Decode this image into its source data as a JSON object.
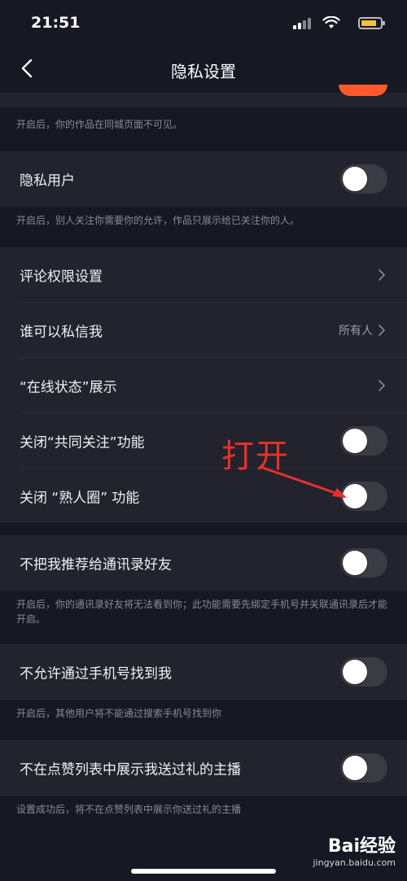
{
  "status": {
    "time": "21:51",
    "battery_color": "#f4c13c"
  },
  "header": {
    "title": "隐私设置"
  },
  "sections": {
    "same_city_desc": "开启后，你的作品在同城页面不可见。",
    "private_user": {
      "label": "隐私用户",
      "desc": "开启后，别人关注你需要你的允许，作品只展示给已关注你的人。",
      "on": false
    },
    "comment_permission": {
      "label": "评论权限设置"
    },
    "who_can_message": {
      "label": "谁可以私信我",
      "value": "所有人"
    },
    "online_status": {
      "label": "“在线状态”展示"
    },
    "mutual_follow": {
      "label": "关闭“共同关注”功能",
      "on": false
    },
    "acquaintance": {
      "label": "关闭 “熟人圈” 功能",
      "on": false
    },
    "no_recommend_contacts": {
      "label": "不把我推荐给通讯录好友",
      "desc": "开启后，你的通讯录好友将无法看到你；此功能需要先绑定手机号并关联通讯录后才能开启。",
      "on": false
    },
    "no_find_by_phone": {
      "label": "不允许通过手机号找到我",
      "desc": "开启后，其他用户将不能通过搜索手机号找到你",
      "on": false
    },
    "hide_gift_likes": {
      "label": "不在点赞列表中展示我送过礼的主播",
      "desc": "设置成功后，将不在点赞列表中展示你送过礼的主播",
      "on": false
    }
  },
  "annotation": {
    "text": "打开",
    "color": "#e4322b"
  },
  "watermark": {
    "logo": "Bai经验",
    "url": "jingyan.baidu.com"
  },
  "colors": {
    "background": "#161823",
    "card": "#22232d",
    "toggle_off": "#3a3b45",
    "toggle_on": "#fe5a2b"
  }
}
